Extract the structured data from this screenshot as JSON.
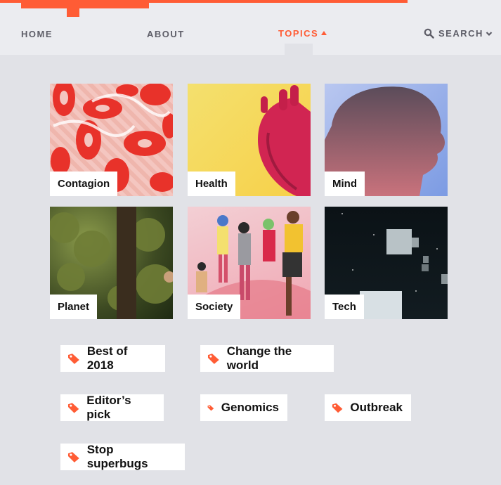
{
  "nav": {
    "home": "HOME",
    "about": "ABOUT",
    "topics": "TOPICS",
    "search": "SEARCH"
  },
  "topics": [
    {
      "label": "Contagion"
    },
    {
      "label": "Health"
    },
    {
      "label": "Mind"
    },
    {
      "label": "Planet"
    },
    {
      "label": "Society"
    },
    {
      "label": "Tech"
    }
  ],
  "tags": [
    {
      "label": "Best of 2018"
    },
    {
      "label": "Change the world"
    },
    {
      "label": "Editor’s pick"
    },
    {
      "label": "Genomics"
    },
    {
      "label": "Outbreak"
    },
    {
      "label": "Stop superbugs"
    }
  ],
  "colors": {
    "accent": "#ff5c35",
    "nav_bg": "#ebecf0",
    "page_bg": "#e1e2e7"
  },
  "icons": {
    "search": "magnifier-icon",
    "tag": "tag-icon"
  }
}
